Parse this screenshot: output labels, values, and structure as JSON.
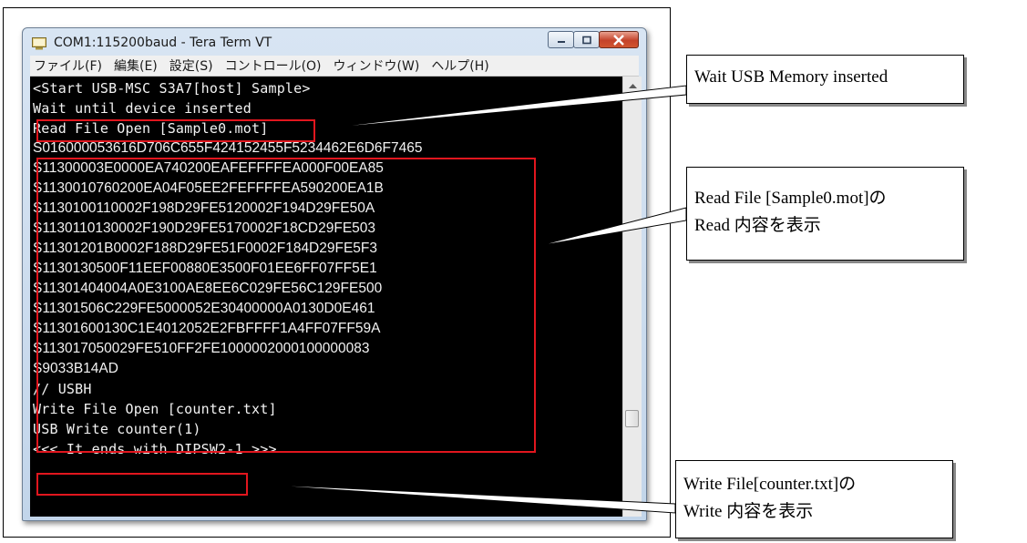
{
  "window": {
    "title": "COM1:115200baud - Tera Term VT",
    "menu": [
      "ファイル(F)",
      "編集(E)",
      "設定(S)",
      "コントロール(O)",
      "ウィンドウ(W)",
      "ヘルプ(H)"
    ]
  },
  "terminal": {
    "lines": [
      "<Start USB-MSC S3A7[host] Sample>",
      "Wait until device inserted",
      "Read File Open [Sample0.mot]",
      "S016000053616D706C655F424152455F5234462E6D6F7465",
      "S11300003E0000EA740200EAFEFFFFEA000F00EA85",
      "S1130010760200EA04F05EE2FEFFFFEA590200EA1B",
      "S1130100110002F198D29FE5120002F194D29FE50A",
      "S1130110130002F190D29FE5170002F18CD29FE503",
      "S11301201B0002F188D29FE51F0002F184D29FE5F3",
      "S1130130500F11EEF00880E3500F01EE6FF07FF5E1",
      "S11301404004A0E3100AE8EE6C029FE56C129FE500",
      "S11301506C229FE5000052E30400000A0130D0E461",
      "S11301600130C1E4012052E2FBFFFF1A4FF07FF59A",
      "S113017050029FE510FF2FE1000002000100000083",
      "S9033B14AD",
      "// USBH",
      "Write File Open [counter.txt]",
      "USB Write counter(1)",
      "<<< It ends with DIPSW2-1 >>>"
    ]
  },
  "callouts": {
    "wait": "Wait USB Memory inserted",
    "read": [
      "Read File [Sample0.mot]の",
      "Read 内容を表示"
    ],
    "write": [
      "Write File[counter.txt]の",
      "Write 内容を表示"
    ]
  },
  "colors": {
    "highlight": "#e1161e",
    "terminal_bg": "#000000",
    "terminal_fg": "#f2f2f2"
  },
  "icons": [
    "tera-term-icon",
    "minimize-icon",
    "maximize-icon",
    "close-icon",
    "scroll-up-icon",
    "scroll-down-icon"
  ]
}
